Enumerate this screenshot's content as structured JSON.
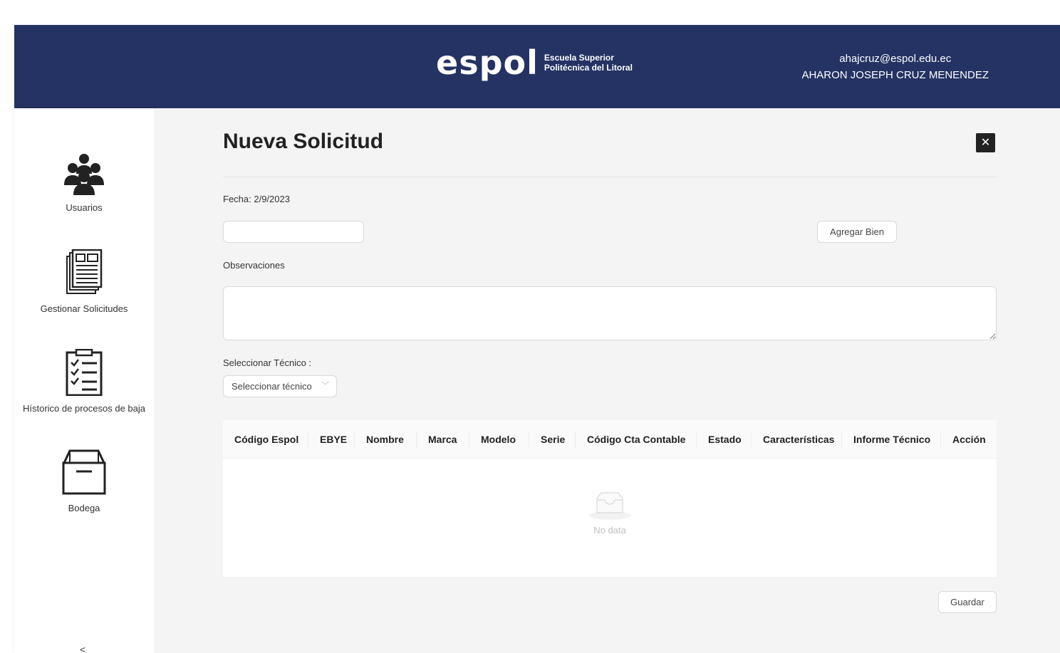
{
  "header": {
    "logo_word": "espol",
    "logo_line1": "Escuela Superior",
    "logo_line2": "Politécnica del Litoral",
    "user_email": "ahajcruz@espol.edu.ec",
    "user_name": "AHARON JOSEPH CRUZ MENENDEZ"
  },
  "sidebar": {
    "items": [
      {
        "label": "Usuarios",
        "icon": "users-group-icon"
      },
      {
        "label": "Gestionar Solicitudes",
        "icon": "newspaper-icon"
      },
      {
        "label": "Hístorico de procesos de baja",
        "icon": "checklist-icon"
      },
      {
        "label": "Bodega",
        "icon": "box-icon"
      }
    ],
    "collapse_glyph": "<"
  },
  "form": {
    "title": "Nueva Solicitud",
    "close_glyph": "✕",
    "fecha_label": "Fecha: 2/9/2023",
    "bien_input_value": "",
    "add_button": "Agregar Bien",
    "observaciones_label": "Observaciones",
    "observaciones_value": "",
    "tecnico_label": "Seleccionar Técnico :",
    "tecnico_select": "Seleccionar técnico",
    "save_button": "Guardar"
  },
  "table": {
    "columns": [
      "Código Espol",
      "EBYE",
      "Nombre",
      "Marca",
      "Modelo",
      "Serie",
      "Código Cta Contable",
      "Estado",
      "Características",
      "Informe Técnico",
      "Acción"
    ],
    "rows": [],
    "empty_text": "No data"
  },
  "colors": {
    "header_bg": "#243363",
    "main_bg": "#f4f4f4"
  }
}
